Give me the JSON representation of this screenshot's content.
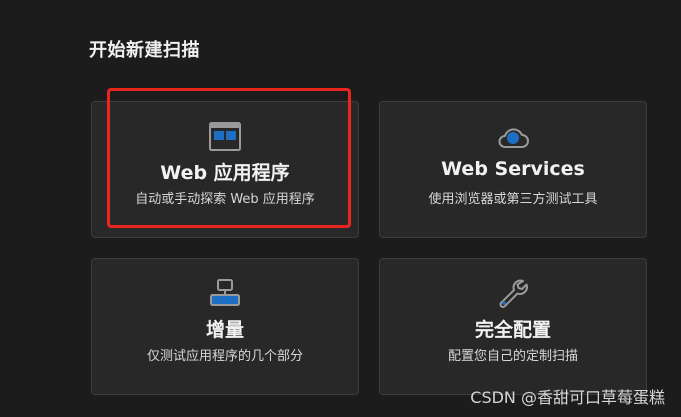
{
  "section": {
    "title": "开始新建扫描"
  },
  "cards": [
    {
      "title": "Web 应用程序",
      "desc": "自动或手动探索 Web 应用程序",
      "icon": "web-app-window-icon"
    },
    {
      "title": "Web Services",
      "desc": "使用浏览器或第三方测试工具",
      "icon": "cloud-globe-icon"
    },
    {
      "title": "增量",
      "desc": "仅测试应用程序的几个部分",
      "icon": "incremental-blocks-icon"
    },
    {
      "title": "完全配置",
      "desc": "配置您自己的定制扫描",
      "icon": "wrench-icon"
    }
  ],
  "colors": {
    "accent": "#1e6fc4",
    "highlight": "#e8261d",
    "card_bg": "#282829",
    "page_bg": "#1c1c1d"
  },
  "watermark": "CSDN @香甜可口草莓蛋糕"
}
